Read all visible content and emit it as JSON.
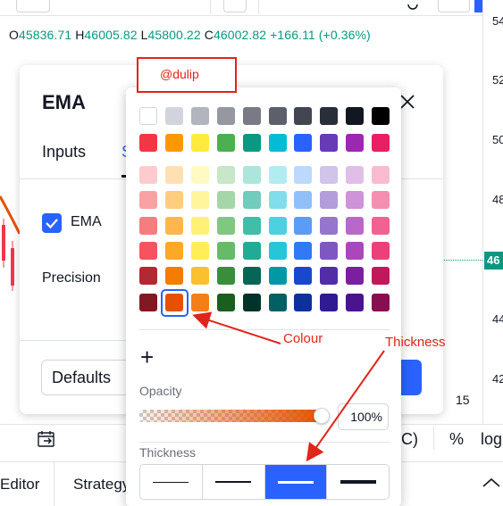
{
  "ohlc": {
    "o_label": "O",
    "o_value": "45836.71",
    "h_label": "H",
    "h_value": "46005.82",
    "l_label": "L",
    "l_value": "45800.22",
    "c_label": "C",
    "c_value": "46002.82",
    "change": "+166.11 (+0.36%)"
  },
  "price_scale": {
    "ticks": [
      "54",
      "52",
      "50",
      "48",
      "46",
      "44",
      "42"
    ],
    "last_price_badge": "46"
  },
  "dialog": {
    "title": "EMA",
    "tabs": [
      {
        "label": "Inputs"
      },
      {
        "label": "S"
      }
    ],
    "ema_checkbox_label": "EMA",
    "precision_label": "Precision",
    "defaults_label": "Defaults"
  },
  "color_picker": {
    "palette_rows": [
      [
        "#ffffff",
        "#d1d4dc",
        "#b2b5be",
        "#9598a1",
        "#787b86",
        "#5d606b",
        "#434651",
        "#2a2e39",
        "#131722",
        "#000000"
      ],
      [
        "#f23645",
        "#ff9800",
        "#ffeb3b",
        "#4caf50",
        "#089981",
        "#00bcd4",
        "#2962ff",
        "#673ab7",
        "#9c27b0",
        "#e91e63"
      ],
      [
        "#fccbcd",
        "#ffe0b2",
        "#fff9c4",
        "#c8e6c9",
        "#ace5dc",
        "#b2ebf2",
        "#bbd9fb",
        "#d1c4e9",
        "#e1bee7",
        "#f8bbd0"
      ],
      [
        "#faa1a4",
        "#ffcc80",
        "#fff59d",
        "#a5d6a7",
        "#70ccbd",
        "#80deea",
        "#90bff9",
        "#b39ddb",
        "#ce93d8",
        "#f48fb1"
      ],
      [
        "#f77c80",
        "#ffb74d",
        "#fff176",
        "#81c784",
        "#42bda8",
        "#4dd0e1",
        "#5b9cf6",
        "#9575cd",
        "#ba68c8",
        "#f06292"
      ],
      [
        "#f7525f",
        "#ffa726",
        "#ffee58",
        "#66bb6a",
        "#22ab94",
        "#26c6da",
        "#3179f5",
        "#7e57c2",
        "#ab47bc",
        "#ec407a"
      ],
      [
        "#b22833",
        "#f57c00",
        "#fbc02d",
        "#388e3c",
        "#056656",
        "#0097a7",
        "#1848cc",
        "#512da8",
        "#7b1fa2",
        "#c2185b"
      ],
      [
        "#801922",
        "#e65100",
        "#f57f17",
        "#1b5e20",
        "#00332a",
        "#006064",
        "#0c3299",
        "#311b92",
        "#4a148c",
        "#880e4f"
      ]
    ],
    "selected": {
      "row": 7,
      "col": 1,
      "color": "#e65100"
    },
    "add_label": "+",
    "opacity_label": "Opacity",
    "opacity_value": "100%",
    "opacity_level": 1.0,
    "thickness_label": "Thickness",
    "thickness_options": [
      1,
      2,
      3,
      4
    ],
    "thickness_selected": 3
  },
  "bottom_axis": {
    "tick_15": "15",
    "percent_label": "%",
    "log_label": "log",
    "paren_label": "C)"
  },
  "bottom_tabs": [
    {
      "label": "Editor"
    },
    {
      "label": "Strategy"
    }
  ],
  "annotations": {
    "watermark": "@dulip",
    "colour_note": "Colour",
    "thickness_note": "Thickness",
    "color": "#e0251b"
  },
  "accent_color": "#2962ff"
}
